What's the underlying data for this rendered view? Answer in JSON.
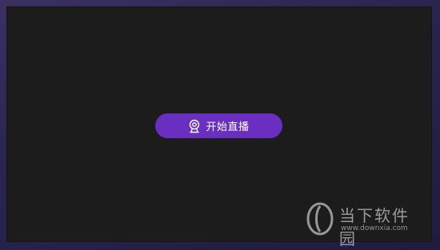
{
  "start_live": {
    "label": "开始直播",
    "icon": "camera-icon",
    "bg_color": "#6a2fc0"
  },
  "watermark": {
    "logo_icon": "downxia-logo-icon",
    "name": "当下软件园",
    "url": "www.downxia.com"
  },
  "colors": {
    "frame": "#2a2550",
    "screen": "#1c1c1c",
    "accent": "#6a2fc0"
  }
}
